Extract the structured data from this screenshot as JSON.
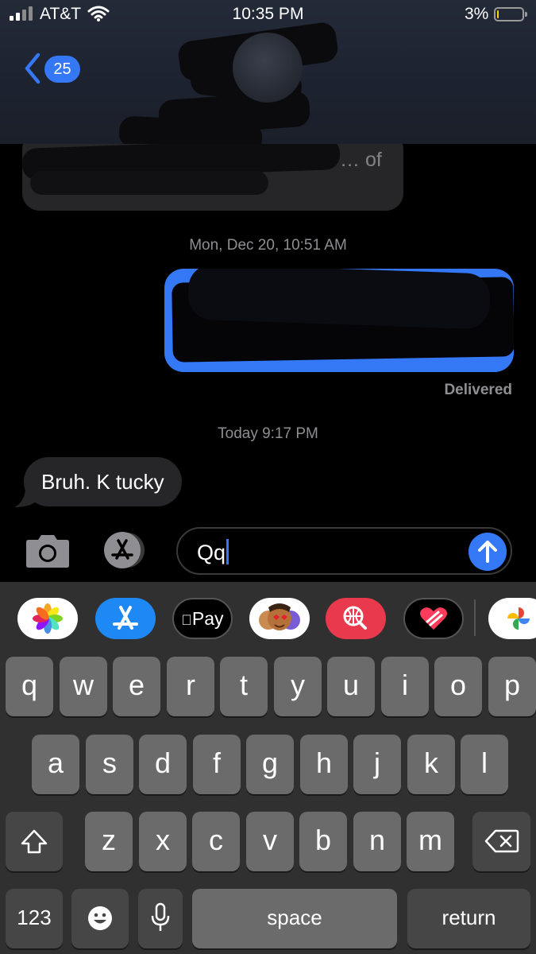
{
  "status_bar": {
    "carrier": "AT&T",
    "time": "10:35 PM",
    "battery_percent": "3%",
    "battery_level": 0.03,
    "icons": [
      "signal-icon",
      "wifi-icon",
      "battery-icon"
    ]
  },
  "header": {
    "back_count": "25",
    "icons": [
      "chevron-left-icon"
    ]
  },
  "conversation": {
    "partial_message": "… of",
    "partial_message_line2": "",
    "timestamp_1": "Mon, Dec 20, 10:51 AM",
    "delivered": "Delivered",
    "timestamp_2": "Today 9:17 PM",
    "received_message": "Bruh. K tucky"
  },
  "composer": {
    "value": "Qq",
    "icons": [
      "camera-icon",
      "app-store-icon",
      "send-arrow-icon"
    ]
  },
  "apps_row": {
    "apple_pay_label": "Pay",
    "icons": [
      "photos-icon",
      "app-store-icon",
      "apple-pay-icon",
      "memoji-icon",
      "image-search-icon",
      "digital-touch-icon",
      "google-photos-icon"
    ]
  },
  "keyboard": {
    "row1": [
      "q",
      "w",
      "e",
      "r",
      "t",
      "y",
      "u",
      "i",
      "o",
      "p"
    ],
    "row2": [
      "a",
      "s",
      "d",
      "f",
      "g",
      "h",
      "j",
      "k",
      "l"
    ],
    "row3": [
      "z",
      "x",
      "c",
      "v",
      "b",
      "n",
      "m"
    ],
    "numbers": "123",
    "space": "space",
    "return": "return",
    "icons": [
      "shift-icon",
      "delete-icon",
      "emoji-icon",
      "microphone-icon"
    ]
  },
  "colors": {
    "accent": "#3478f6",
    "bubble_gray": "#262628",
    "key": "#6b6b6b",
    "key_dark": "#464646",
    "keyboard_bg": "#303030",
    "battery_low": "#ffd60a"
  }
}
